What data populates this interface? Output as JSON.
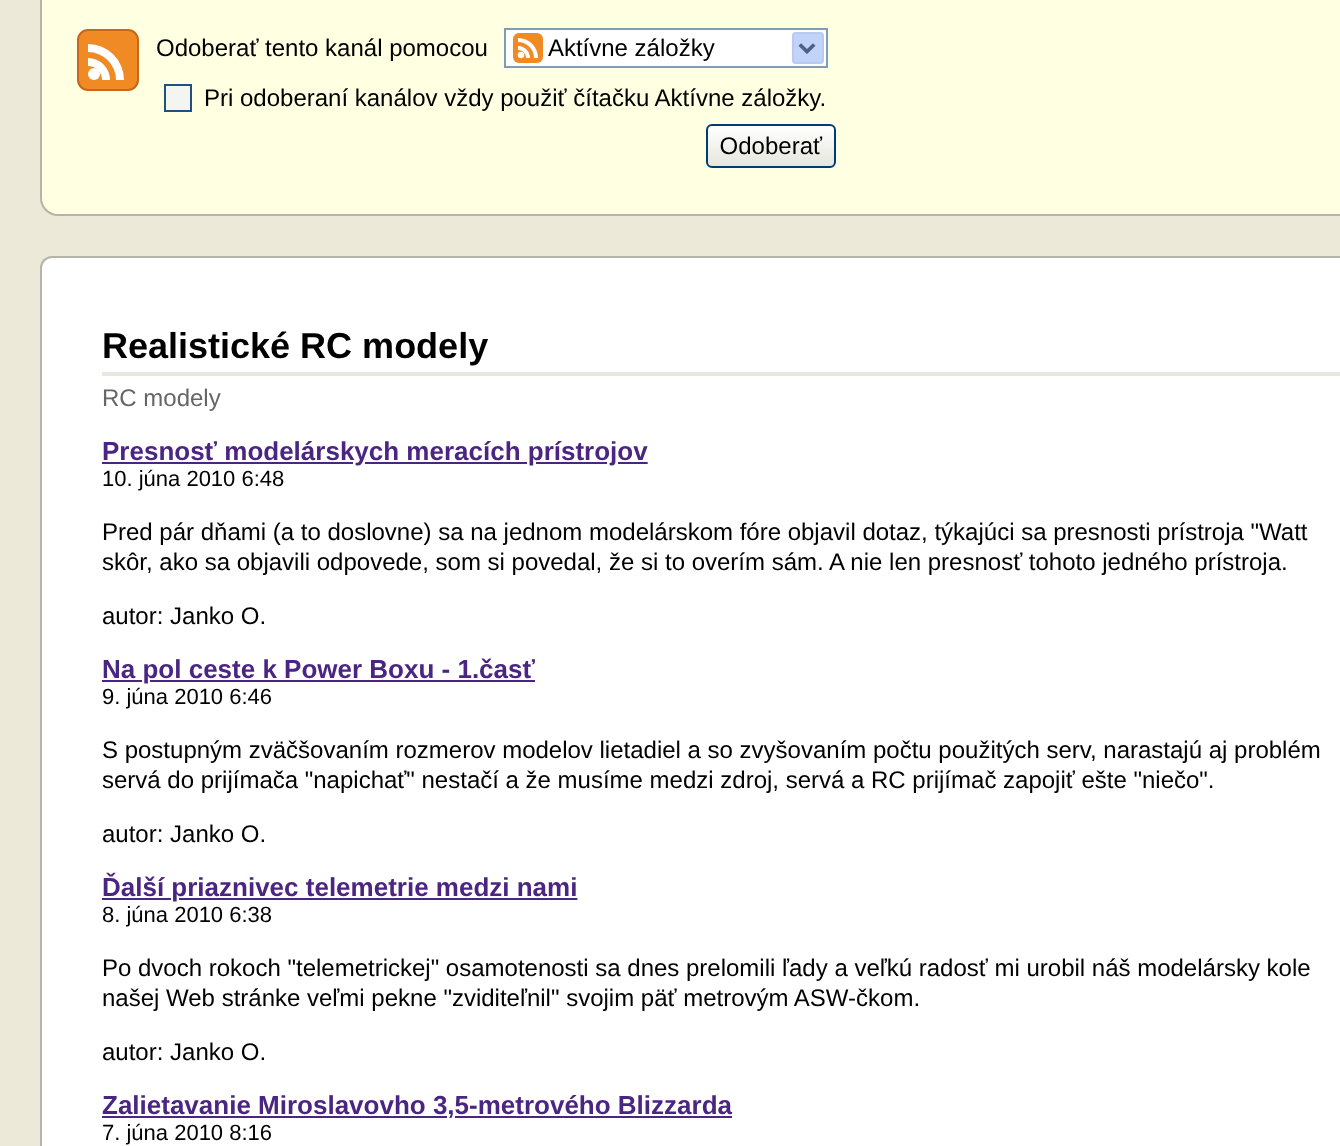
{
  "subscribe": {
    "label": "Odoberať tento kanál pomocou",
    "reader": "Aktívne záložky",
    "always_use": {
      "label": "Pri odoberaní kanálov vždy použiť čítačku Aktívne záložky.",
      "checked": false
    },
    "button": "Odoberať"
  },
  "feed": {
    "title": "Realistické RC modely",
    "subtitle": "RC modely",
    "entries": [
      {
        "title": "Presnosť modelárskych meracích prístrojov",
        "date": "10. júna 2010 6:48",
        "lines": [
          "Pred pár dňami (a to doslovne) sa na jednom modelárskom fóre objavil dotaz, týkajúci sa presnosti prístroja \"Watt",
          "skôr, ako sa objavili odpovede, som si povedal, že si to overím sám. A nie len presnosť tohoto jedného prístroja."
        ],
        "author": "autor: Janko O."
      },
      {
        "title": "Na pol ceste k Power Boxu - 1.časť",
        "date": "9. júna 2010 6:46",
        "lines": [
          "S postupným zväčšovaním rozmerov modelov lietadiel a so zvyšovaním počtu použitých serv, narastajú aj problém",
          "servá do prijímača \"napichať\" nestačí a že musíme medzi zdroj, servá a RC prijímač zapojiť ešte \"niečo\"."
        ],
        "author": "autor: Janko O."
      },
      {
        "title": "Ďalší priaznivec telemetrie medzi nami",
        "date": "8. júna 2010 6:38",
        "lines": [
          "Po dvoch rokoch \"telemetrickej\" osamotenosti sa dnes prelomili ľady a veľkú radosť mi urobil náš modelársky kole",
          "našej Web stránke veľmi pekne \"zviditeľnil\" svojim päť metrovým ASW-čkom."
        ],
        "author": "autor: Janko O."
      },
      {
        "title": "Zalietavanie Miroslavovho 3,5-metrového Blizzarda",
        "date": "7. júna 2010 8:16"
      }
    ]
  }
}
